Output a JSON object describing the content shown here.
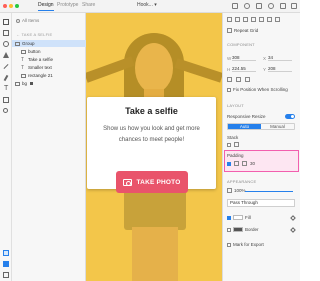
{
  "topbar": {
    "tabs": [
      "Design",
      "Prototype",
      "Share"
    ],
    "active_tab": "Design",
    "document_title": "Hook... ▾",
    "window_dots": [
      "#ff5f57",
      "#febc2e",
      "#28c840"
    ]
  },
  "layers_panel": {
    "search_placeholder": "All Items",
    "breadcrumb": "← TAKE A SELFIE",
    "items": [
      {
        "label": "Group",
        "kind": "group",
        "selected": true
      },
      {
        "label": "button",
        "kind": "group",
        "selected": false
      },
      {
        "label": "Take a selfie",
        "kind": "text",
        "selected": false
      },
      {
        "label": "Smaller text",
        "kind": "text",
        "selected": false
      },
      {
        "label": "rectangle 21",
        "kind": "shape",
        "selected": false
      },
      {
        "label": "bg",
        "kind": "image",
        "selected": false
      }
    ]
  },
  "card": {
    "title": "Take a selfie",
    "body": "Show us how you look and get more chances to meet people!",
    "button_label": "TAKE PHOTO",
    "button_color": "#e9546b",
    "background_color": "#f3c64a"
  },
  "inspector": {
    "repeat_grid_label": "Repeat Grid",
    "component_section": "COMPONENT",
    "w_label": "W",
    "w_value": "308",
    "x_label": "X",
    "x_value": "34",
    "h_label": "H",
    "h_value": "224.55",
    "y_label": "Y",
    "y_value": "208",
    "fix_position_label": "Fix Position When Scrolling",
    "layout_section": "LAYOUT",
    "responsive_resize_label": "Responsive Resize",
    "resize_modes": [
      "Auto",
      "Manual"
    ],
    "active_resize_mode": "Auto",
    "stack_label": "Stack",
    "padding_label": "Padding",
    "padding_value": "30",
    "appearance_section": "APPEARANCE",
    "opacity_value": "100%",
    "blend_mode": "Pass Through",
    "fill_label": "Fill",
    "border_label": "Border",
    "export_label": "Mark for Export",
    "accent_color": "#2680eb",
    "padding_highlight_color": "#f25fae"
  }
}
